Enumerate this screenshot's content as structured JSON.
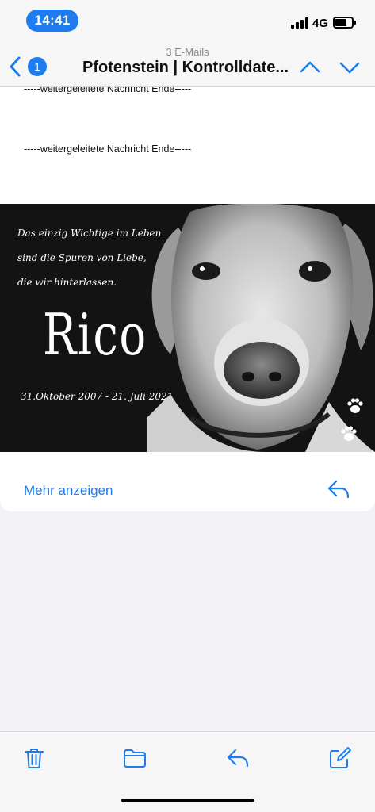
{
  "status_bar": {
    "time": "14:41",
    "network": "4G"
  },
  "nav": {
    "message_count": "3 E-Mails",
    "unread_badge": "1",
    "title": "Pfotenstein | Kontrolldate...",
    "icons": [
      "chevron-left-icon",
      "chevron-up-icon",
      "chevron-down-icon"
    ]
  },
  "mail": {
    "forward_end_1": "-----weitergeleitete Nachricht Ende-----",
    "forward_end_2": "-----weitergeleitete Nachricht Ende-----",
    "memorial": {
      "quote_line_1": "Das einzig Wichtige im Leben",
      "quote_line_2": "sind die Spuren von Liebe,",
      "quote_line_3": "die wir hinterlassen.",
      "name": "Rico",
      "dates": "31.Oktober 2007  - 21. Juli 2021"
    },
    "show_more": "Mehr anzeigen"
  },
  "toolbar": {
    "icons": [
      "trash-icon",
      "folder-icon",
      "reply-icon",
      "compose-icon"
    ]
  },
  "colors": {
    "accent": "#1c7cf0",
    "background": "#f2f2f7",
    "memorial_bg": "#131313"
  }
}
